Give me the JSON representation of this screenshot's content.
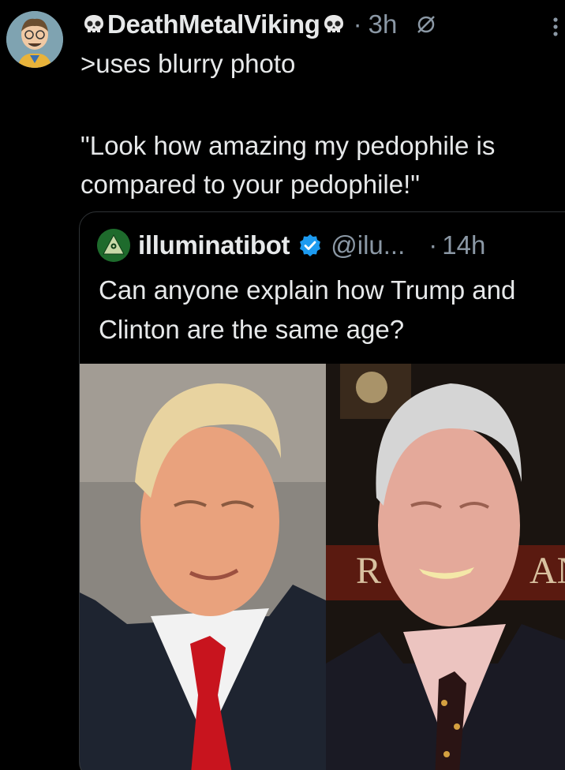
{
  "post": {
    "author_name": "DeathMetalViking",
    "time": "3h",
    "separator": "·",
    "text_line1": ">uses blurry photo",
    "text_line2": "\"Look how amazing my pedophile is compared to your pedophile!\"",
    "icons": {
      "avatar": "cartoon-avatar",
      "name_emoji": "skull-icon",
      "grok": "grok-icon",
      "more": "more-vertical-icon"
    }
  },
  "quote": {
    "author_name": "illuminatibot",
    "handle": "@ilu...",
    "separator": "·",
    "time": "14h",
    "text": "Can anyone explain how Trump and Clinton are the same age?",
    "verified_color": "#1d9bf0",
    "image_alt": "Side-by-side photos of Donald Trump and Bill Clinton"
  },
  "colors": {
    "background": "#000000",
    "text": "#e7e9ea",
    "secondary": "#8b98a5",
    "border": "#2f3336"
  }
}
